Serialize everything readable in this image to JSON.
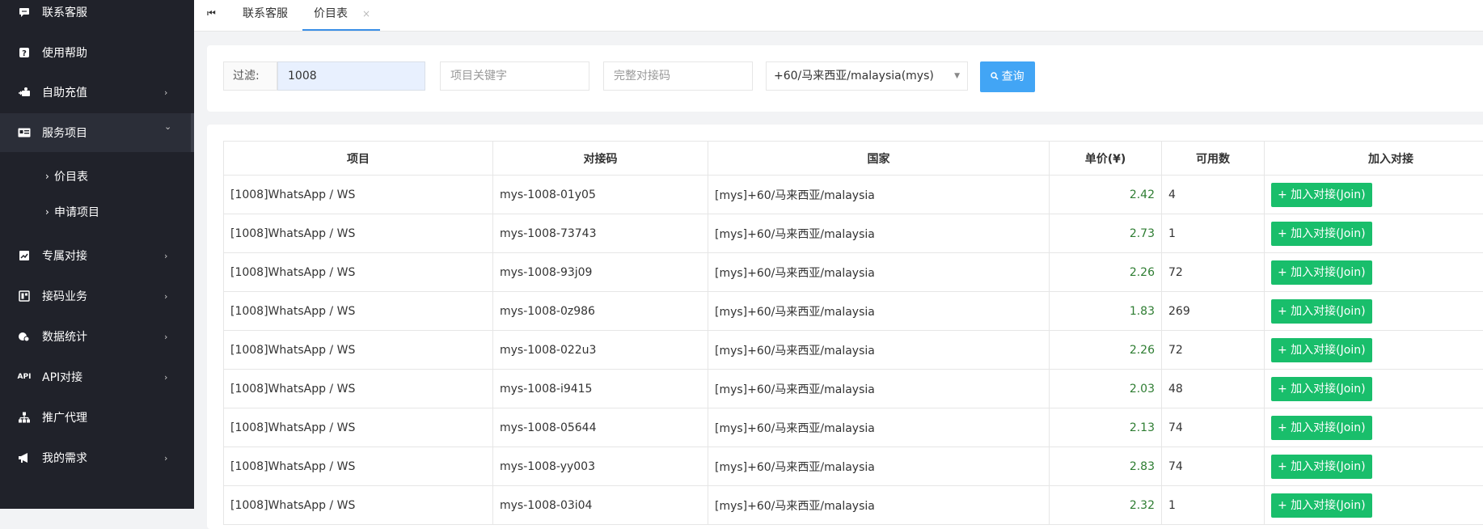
{
  "sidebar": {
    "items": [
      {
        "label": "联系客服",
        "icon": "chat-icon",
        "arrow": ""
      },
      {
        "label": "使用帮助",
        "icon": "help-icon",
        "arrow": ""
      },
      {
        "label": "自助充值",
        "icon": "recharge-icon",
        "arrow": "›"
      },
      {
        "label": "服务项目",
        "icon": "service-icon",
        "arrow": "⌄"
      },
      {
        "label": "专属对接",
        "icon": "exclusive-icon",
        "arrow": "›"
      },
      {
        "label": "接码业务",
        "icon": "sms-icon",
        "arrow": "›"
      },
      {
        "label": "数据统计",
        "icon": "stats-icon",
        "arrow": "›"
      },
      {
        "label": "API对接",
        "icon": "api-icon",
        "arrow": "›"
      },
      {
        "label": "推广代理",
        "icon": "agent-icon",
        "arrow": ""
      },
      {
        "label": "我的需求",
        "icon": "megaphone-icon",
        "arrow": "›"
      }
    ],
    "sub_items": [
      {
        "label": "价目表",
        "caret": "›"
      },
      {
        "label": "申请项目",
        "caret": "›"
      }
    ],
    "api_icon_text": "API"
  },
  "tabs": {
    "home_icon": "⏮",
    "items": [
      {
        "label": "联系客服"
      },
      {
        "label": "价目表",
        "close": "×"
      }
    ]
  },
  "filter": {
    "label": "过滤:",
    "keyword_value": "1008",
    "name_placeholder": "项目关键字",
    "code_placeholder": "完整对接码",
    "country_selected": "+60/马来西亚/malaysia(mys)",
    "search_button": "查询",
    "search_icon": "🔍"
  },
  "table": {
    "headers": [
      "项目",
      "对接码",
      "国家",
      "单价(¥)",
      "可用数",
      "加入对接"
    ],
    "join_label": "+ 加入对接(Join)",
    "rows": [
      {
        "project": "[1008]WhatsApp / WS",
        "code": "mys-1008-01y05",
        "country": "[mys]+60/马来西亚/malaysia",
        "price": "2.42",
        "count": "4"
      },
      {
        "project": "[1008]WhatsApp / WS",
        "code": "mys-1008-73743",
        "country": "[mys]+60/马来西亚/malaysia",
        "price": "2.73",
        "count": "1"
      },
      {
        "project": "[1008]WhatsApp / WS",
        "code": "mys-1008-93j09",
        "country": "[mys]+60/马来西亚/malaysia",
        "price": "2.26",
        "count": "72"
      },
      {
        "project": "[1008]WhatsApp / WS",
        "code": "mys-1008-0z986",
        "country": "[mys]+60/马来西亚/malaysia",
        "price": "1.83",
        "count": "269"
      },
      {
        "project": "[1008]WhatsApp / WS",
        "code": "mys-1008-022u3",
        "country": "[mys]+60/马来西亚/malaysia",
        "price": "2.26",
        "count": "72"
      },
      {
        "project": "[1008]WhatsApp / WS",
        "code": "mys-1008-i9415",
        "country": "[mys]+60/马来西亚/malaysia",
        "price": "2.03",
        "count": "48"
      },
      {
        "project": "[1008]WhatsApp / WS",
        "code": "mys-1008-05644",
        "country": "[mys]+60/马来西亚/malaysia",
        "price": "2.13",
        "count": "74"
      },
      {
        "project": "[1008]WhatsApp / WS",
        "code": "mys-1008-yy003",
        "country": "[mys]+60/马来西亚/malaysia",
        "price": "2.83",
        "count": "74"
      },
      {
        "project": "[1008]WhatsApp / WS",
        "code": "mys-1008-03i04",
        "country": "[mys]+60/马来西亚/malaysia",
        "price": "2.32",
        "count": "1"
      }
    ]
  },
  "colors": {
    "sidebar_bg": "#20222a",
    "accent": "#42a5f5",
    "join": "#19be6b",
    "price": "#2e7d32"
  }
}
